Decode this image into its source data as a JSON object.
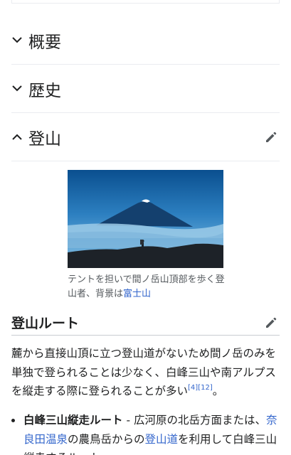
{
  "sections": [
    {
      "title": "概要",
      "expanded": false
    },
    {
      "title": "歴史",
      "expanded": false
    },
    {
      "title": "登山",
      "expanded": true
    }
  ],
  "figure": {
    "caption_prefix": "テントを担いで間ノ岳山頂部を歩く登山者、背景は",
    "caption_link": "富士山"
  },
  "subsection": {
    "title": "登山ルート"
  },
  "paragraph": {
    "text": "麓から直接山頂に立つ登山道がないため間ノ岳のみを単独で登られることは少なく、白峰三山や南アルプスを縦走する際に登られることが多い",
    "ref1": "[4]",
    "ref2": "[12]",
    "end": "。"
  },
  "list_item": {
    "bold": "白峰三山縦走ルート",
    "t1": " - 広河原の北岳方面または、",
    "link1": "奈良田温泉",
    "t2": "の農鳥岳からの",
    "link2": "登山道",
    "t3": "を利用して白峰三山縦走するルート。"
  },
  "colors": {
    "link": "#3366cc",
    "text": "#202122",
    "caption": "#54595d",
    "divider": "#eaecf0"
  },
  "icons": [
    "chevron-down-icon",
    "chevron-up-icon",
    "edit-pencil-icon"
  ]
}
